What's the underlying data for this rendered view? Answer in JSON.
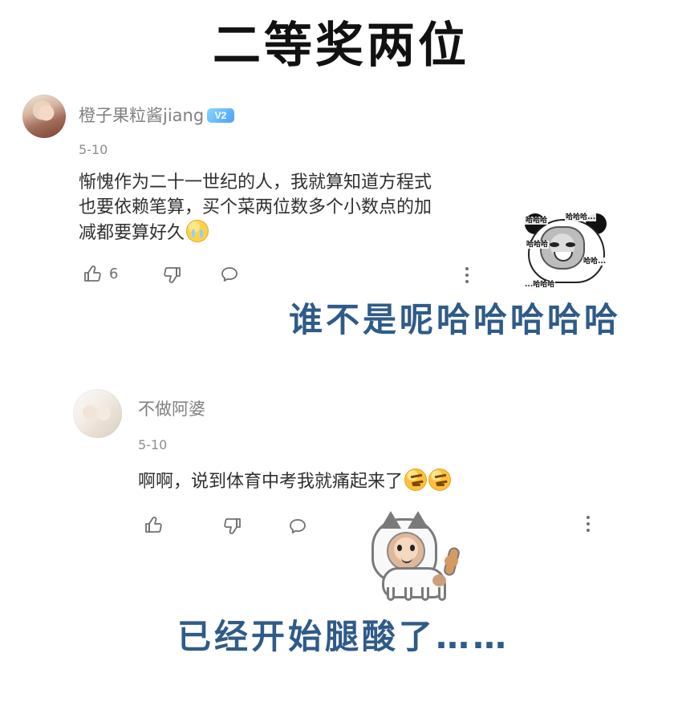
{
  "header": {
    "title": "二等奖两位"
  },
  "comments": [
    {
      "username": "橙子果粒酱jiang",
      "badge": "V2",
      "date": "5-10",
      "text_lines": [
        "惭愧作为二十一世纪的人，我就算知道方程式",
        "也要依赖笔算，买个菜两位数多个小数点的加",
        "减都要算好久"
      ],
      "emoji": "crying-face",
      "actions": {
        "like_count": "6"
      }
    },
    {
      "username": "不做阿婆",
      "date": "5-10",
      "text": "啊啊，说到体育中考我就痛起来了",
      "emojis": [
        "angry-face",
        "angry-face"
      ]
    }
  ],
  "overlays": [
    "谁不是呢哈哈哈哈哈",
    "已经开始腿酸了……"
  ],
  "stickers": {
    "panda_labels": [
      "哈哈哈",
      "哈哈哈...",
      "哈哈哈",
      "哈哈...",
      "...哈哈哈"
    ]
  },
  "icons": {
    "like": "thumb-up-icon",
    "dislike": "thumb-down-icon",
    "reply": "comment-bubble-icon",
    "more": "more-vertical-icon"
  },
  "colors": {
    "overlay_text": "#2f5b89",
    "username": "#808080",
    "badge_gradient_start": "#86d7ff",
    "badge_gradient_end": "#4d9eff"
  }
}
